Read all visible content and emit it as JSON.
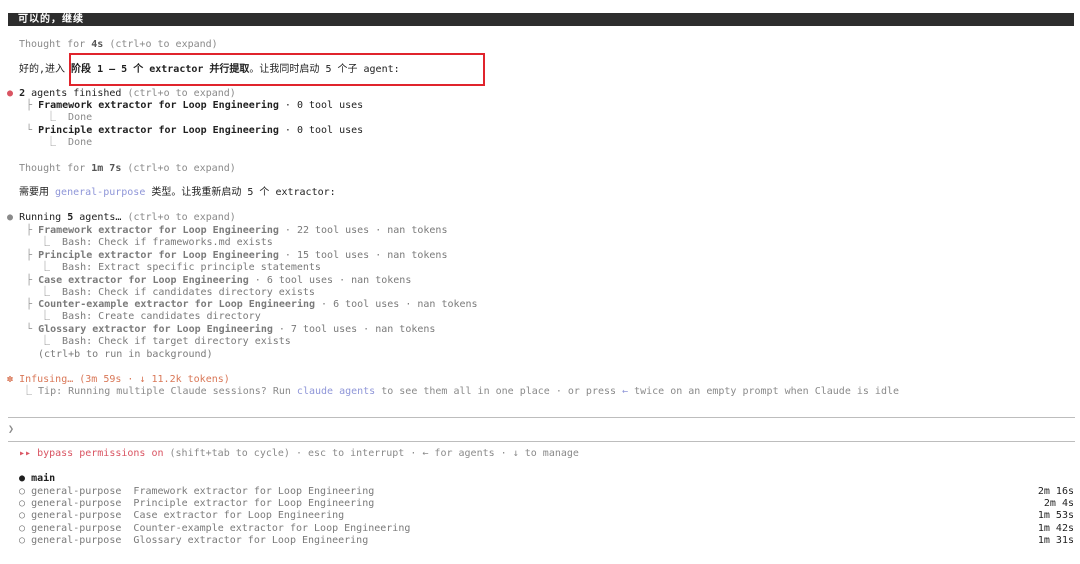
{
  "user_message": "可以的，继续",
  "thought1": {
    "prefix": "Thought for ",
    "duration": "4s",
    "hint": " (ctrl+o to expand)"
  },
  "reply1": {
    "lead": "好的,进入 ",
    "bold": "阶段 1 — 5 个 extractor 并行提取",
    "tail": "。让我同时启动 5 个子 agent:"
  },
  "finished": {
    "bullet": "●",
    "count": "2",
    "label": " agents finished",
    "hint": " (ctrl+o to expand)",
    "items": [
      {
        "branch": "├",
        "name": "Framework extractor for Loop Engineering",
        "stats": " · 0 tool uses",
        "sub_glyph": "⎿",
        "sub": "Done"
      },
      {
        "branch": "└",
        "name": "Principle extractor for Loop Engineering",
        "stats": " · 0 tool uses",
        "sub_glyph": "⎿",
        "sub": "Done"
      }
    ]
  },
  "thought2": {
    "prefix": "Thought for ",
    "duration": "1m 7s",
    "hint": " (ctrl+o to expand)"
  },
  "reply2": {
    "lead": "需要用 ",
    "type": "general-purpose",
    "tail": " 类型。让我重新启动 5 个 extractor:"
  },
  "running": {
    "bullet": "●",
    "prefix": "Running ",
    "count": "5",
    "label": " agents…",
    "hint": " (ctrl+o to expand)",
    "items": [
      {
        "branch": "├",
        "name": "Framework extractor for Loop Engineering",
        "stats": " · 22 tool uses · nan tokens",
        "sub_glyph": "⎿",
        "sub": "Bash: Check if frameworks.md exists"
      },
      {
        "branch": "├",
        "name": "Principle extractor for Loop Engineering",
        "stats": " · 15 tool uses · nan tokens",
        "sub_glyph": "⎿",
        "sub": "Bash: Extract specific principle statements"
      },
      {
        "branch": "├",
        "name": "Case extractor for Loop Engineering",
        "stats": " · 6 tool uses · nan tokens",
        "sub_glyph": "⎿",
        "sub": "Bash: Check if candidates directory exists"
      },
      {
        "branch": "├",
        "name": "Counter-example extractor for Loop Engineering",
        "stats": " · 6 tool uses · nan tokens",
        "sub_glyph": "⎿",
        "sub": "Bash: Create candidates directory"
      },
      {
        "branch": "└",
        "name": "Glossary extractor for Loop Engineering",
        "stats": " · 7 tool uses · nan tokens",
        "sub_glyph": "⎿",
        "sub": "Bash: Check if target directory exists"
      }
    ],
    "background_hint": "(ctrl+b to run in background)"
  },
  "status": {
    "glyph": "✽",
    "text": "Infusing…",
    "meta": " (3m 59s · ↓ 11.2k tokens)",
    "tip_glyph": "⎿",
    "tip_pre": "Tip: Running multiple Claude sessions? Run ",
    "tip_cmd": "claude agents",
    "tip_mid": " to see them all in one place · or press ",
    "tip_arrow": "←",
    "tip_post": " twice on an empty prompt when Claude is idle"
  },
  "prompt": {
    "glyph": "❯",
    "value": ""
  },
  "footer": {
    "glyph": "▸▸",
    "mode": " bypass permissions on",
    "rest": " (shift+tab to cycle) · esc to interrupt · ← for agents · ↓ to manage"
  },
  "agents_panel": {
    "main_glyph": "●",
    "main_label": "main",
    "rows": [
      {
        "glyph": "○",
        "type": "general-purpose",
        "desc": "Framework extractor for Loop Engineering",
        "time": "2m 16s"
      },
      {
        "glyph": "○",
        "type": "general-purpose",
        "desc": "Principle extractor for Loop Engineering",
        "time": "2m 4s"
      },
      {
        "glyph": "○",
        "type": "general-purpose",
        "desc": "Case extractor for Loop Engineering",
        "time": "1m 53s"
      },
      {
        "glyph": "○",
        "type": "general-purpose",
        "desc": "Counter-example extractor for Loop Engineering",
        "time": "1m 42s"
      },
      {
        "glyph": "○",
        "type": "general-purpose",
        "desc": "Glossary extractor for Loop Engineering",
        "time": "1m 31s"
      }
    ]
  },
  "colors": {
    "accent_red": "#d95462",
    "accent_orange": "#d97757",
    "link_blue": "#8f96d8",
    "highlight_border": "#e0242c"
  }
}
